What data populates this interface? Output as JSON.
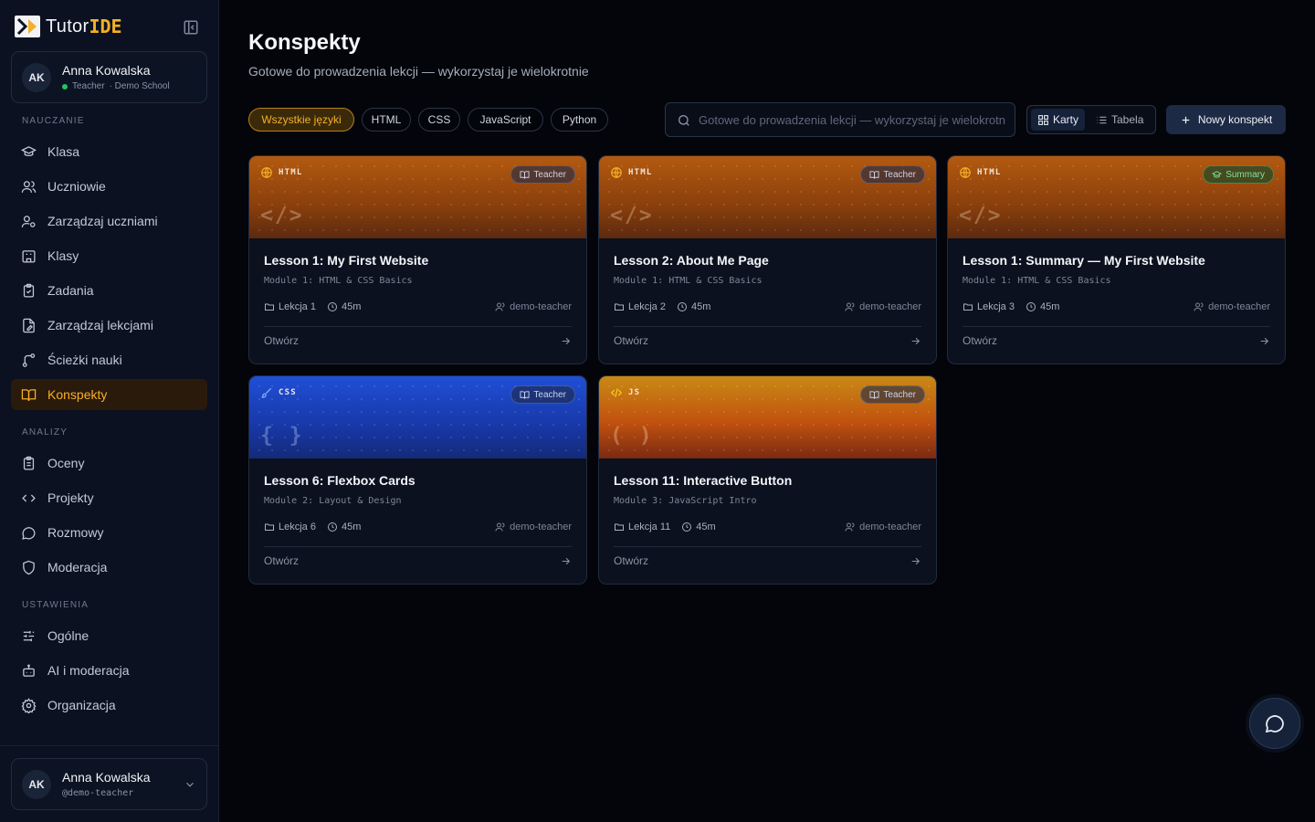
{
  "app": {
    "name_part1": "Tutor",
    "name_part2": "IDE"
  },
  "user_top": {
    "initials": "AK",
    "name": "Anna Kowalska",
    "role": "Teacher",
    "school": "· Demo School"
  },
  "sidebar": {
    "sections": [
      {
        "title": "NAUCZANIE",
        "items": [
          {
            "label": "Klasa",
            "icon": "graduation-cap-icon"
          },
          {
            "label": "Uczniowie",
            "icon": "users-icon"
          },
          {
            "label": "Zarządzaj uczniami",
            "icon": "user-cog-icon"
          },
          {
            "label": "Klasy",
            "icon": "school-icon"
          },
          {
            "label": "Zadania",
            "icon": "clipboard-icon"
          },
          {
            "label": "Zarządzaj lekcjami",
            "icon": "file-edit-icon"
          },
          {
            "label": "Ścieżki nauki",
            "icon": "route-icon"
          },
          {
            "label": "Konspekty",
            "icon": "book-open-icon",
            "active": true
          }
        ]
      },
      {
        "title": "ANALIZY",
        "items": [
          {
            "label": "Oceny",
            "icon": "clipboard-list-icon"
          },
          {
            "label": "Projekty",
            "icon": "code-icon"
          },
          {
            "label": "Rozmowy",
            "icon": "message-circle-icon"
          },
          {
            "label": "Moderacja",
            "icon": "shield-icon"
          }
        ]
      },
      {
        "title": "USTAWIENIA",
        "items": [
          {
            "label": "Ogólne",
            "icon": "sliders-icon"
          },
          {
            "label": "AI i moderacja",
            "icon": "bot-icon"
          },
          {
            "label": "Organizacja",
            "icon": "gear-icon"
          }
        ]
      }
    ]
  },
  "user_bottom": {
    "initials": "AK",
    "name": "Anna Kowalska",
    "handle": "@demo-teacher"
  },
  "page": {
    "title": "Konspekty",
    "subtitle": "Gotowe do prowadzenia lekcji — wykorzystaj je wielokrotnie"
  },
  "filters": [
    "Wszystkie języki",
    "HTML",
    "CSS",
    "JavaScript",
    "Python"
  ],
  "active_filter": "Wszystkie języki",
  "search": {
    "placeholder": "Gotowe do prowadzenia lekcji — wykorzystaj je wielokrotnie",
    "value": ""
  },
  "view_toggle": {
    "cards": "Karty",
    "table": "Tabela",
    "active": "Karty"
  },
  "new_button": "Nowy konspekt",
  "cards": [
    {
      "lang": "HTML",
      "badge": "Teacher",
      "glyph": "</>",
      "title": "Lesson 1: My First Website",
      "module": "Module 1: HTML & CSS Basics",
      "lesson": "Lekcja 1",
      "duration": "45m",
      "author": "demo-teacher",
      "open": "Otwórz"
    },
    {
      "lang": "HTML",
      "badge": "Teacher",
      "glyph": "</>",
      "title": "Lesson 2: About Me Page",
      "module": "Module 1: HTML & CSS Basics",
      "lesson": "Lekcja 2",
      "duration": "45m",
      "author": "demo-teacher",
      "open": "Otwórz"
    },
    {
      "lang": "HTML",
      "badge": "Summary",
      "glyph": "</>",
      "title": "Lesson 1: Summary — My First Website",
      "module": "Module 1: HTML & CSS Basics",
      "lesson": "Lekcja 3",
      "duration": "45m",
      "author": "demo-teacher",
      "open": "Otwórz"
    },
    {
      "lang": "CSS",
      "badge": "Teacher",
      "glyph": "{ }",
      "title": "Lesson 6: Flexbox Cards",
      "module": "Module 2: Layout & Design",
      "lesson": "Lekcja 6",
      "duration": "45m",
      "author": "demo-teacher",
      "open": "Otwórz"
    },
    {
      "lang": "JS",
      "badge": "Teacher",
      "glyph": "( )",
      "title": "Lesson 11: Interactive Button",
      "module": "Module 3: JavaScript Intro",
      "lesson": "Lekcja 11",
      "duration": "45m",
      "author": "demo-teacher",
      "open": "Otwórz"
    }
  ],
  "colors": {
    "accent": "#f6b026",
    "html_banner": "#9a4a0c",
    "css_banner": "#1a3fb8",
    "js_banner": "#c2520f",
    "background": "#03050a",
    "sidebar": "#0b1120"
  }
}
